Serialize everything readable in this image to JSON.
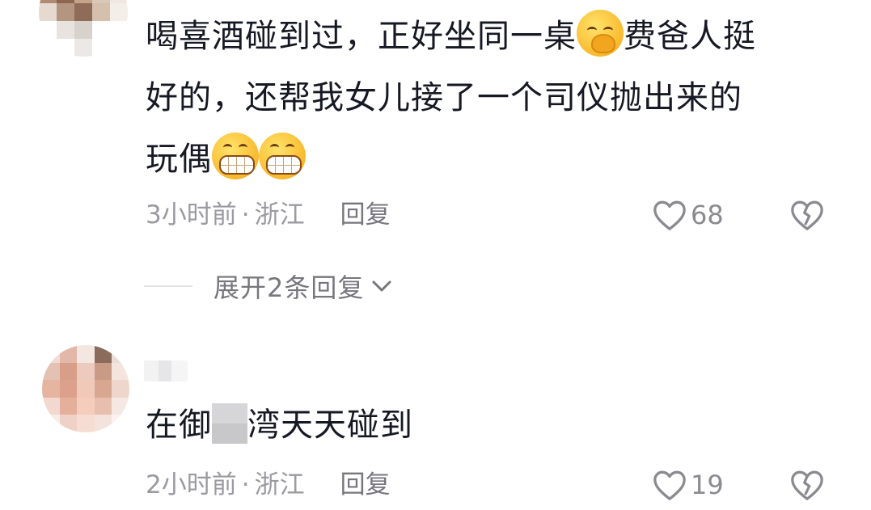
{
  "comments": [
    {
      "text_lines": [
        "喝喜酒碰到过，正好坐同一桌",
        "费爸人挺",
        "好的，还帮我女儿接了一个司仪抛出来的",
        "玩偶"
      ],
      "time": "3小时前",
      "dot": "·",
      "location": "浙江",
      "reply_label": "回复",
      "likes": "68",
      "emojis": [
        "shy-face-icon",
        "grin-face-icon",
        "grin-face-icon"
      ]
    },
    {
      "text_prefix": "在御",
      "text_suffix": "湾天天碰到",
      "time": "2小时前",
      "dot": "·",
      "location": "浙江",
      "reply_label": "回复",
      "likes": "19"
    }
  ],
  "expand_replies": {
    "label": "展开2条回复"
  },
  "colors": {
    "text": "#161823",
    "meta": "#9a9aa0",
    "icon": "#8a8a90"
  }
}
